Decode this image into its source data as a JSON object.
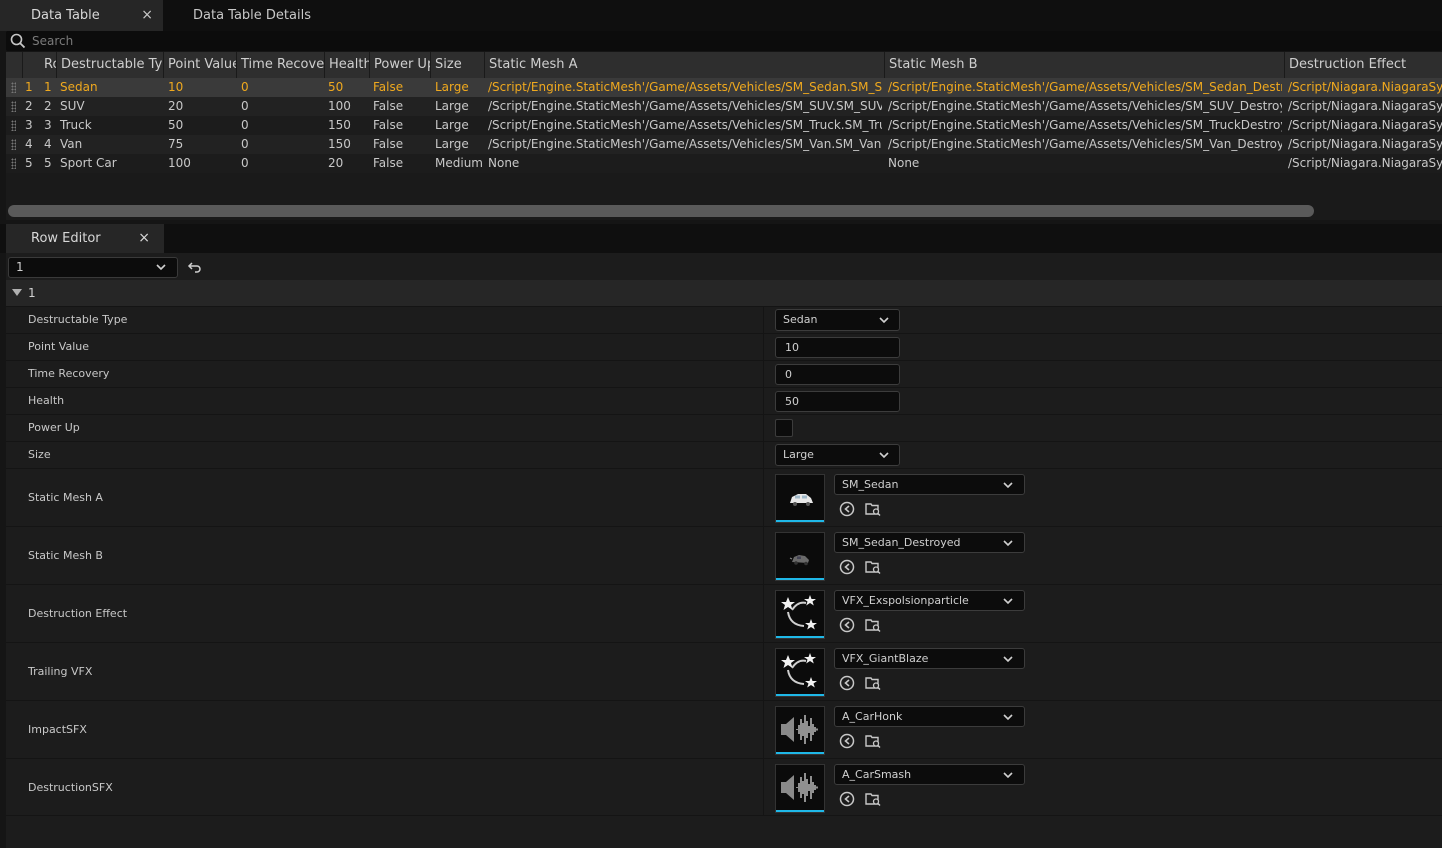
{
  "tabs": [
    {
      "label": "Data Table",
      "close": "×"
    },
    {
      "label": "Data Table Details"
    }
  ],
  "search": {
    "placeholder": "Search"
  },
  "table": {
    "headers": [
      "Ro",
      "Destructable Type",
      "Point Value",
      "Time Recovery",
      "Health",
      "Power Up",
      "Size",
      "Static Mesh A",
      "Static Mesh B",
      "Destruction Effect"
    ],
    "rows": [
      {
        "idx": "1",
        "row": "1",
        "type": "Sedan",
        "points": "10",
        "time": "0",
        "health": "50",
        "power": "False",
        "size": "Large",
        "meshA": "/Script/Engine.StaticMesh'/Game/Assets/Vehicles/SM_Sedan.SM_Sedan'",
        "meshB": "/Script/Engine.StaticMesh'/Game/Assets/Vehicles/SM_Sedan_Destroyed",
        "effect": "/Script/Niagara.NiagaraSystem"
      },
      {
        "idx": "2",
        "row": "2",
        "type": "SUV",
        "points": "20",
        "time": "0",
        "health": "100",
        "power": "False",
        "size": "Large",
        "meshA": "/Script/Engine.StaticMesh'/Game/Assets/Vehicles/SM_SUV.SM_SUV'",
        "meshB": "/Script/Engine.StaticMesh'/Game/Assets/Vehicles/SM_SUV_Destroyed.SM",
        "effect": "/Script/Niagara.NiagaraSystem"
      },
      {
        "idx": "3",
        "row": "3",
        "type": "Truck",
        "points": "50",
        "time": "0",
        "health": "150",
        "power": "False",
        "size": "Large",
        "meshA": "/Script/Engine.StaticMesh'/Game/Assets/Vehicles/SM_Truck.SM_Truck'",
        "meshB": "/Script/Engine.StaticMesh'/Game/Assets/Vehicles/SM_TruckDestroyed.SM",
        "effect": "/Script/Niagara.NiagaraSystem"
      },
      {
        "idx": "4",
        "row": "4",
        "type": "Van",
        "points": "75",
        "time": "0",
        "health": "150",
        "power": "False",
        "size": "Large",
        "meshA": "/Script/Engine.StaticMesh'/Game/Assets/Vehicles/SM_Van.SM_Van'",
        "meshB": "/Script/Engine.StaticMesh'/Game/Assets/Vehicles/SM_Van_Destroyed.SM",
        "effect": "/Script/Niagara.NiagaraSystem"
      },
      {
        "idx": "5",
        "row": "5",
        "type": "Sport Car",
        "points": "100",
        "time": "0",
        "health": "20",
        "power": "False",
        "size": "Medium",
        "meshA": "None",
        "meshB": "None",
        "effect": "/Script/Niagara.NiagaraSystem"
      }
    ]
  },
  "row_editor": {
    "tab_label": "Row Editor",
    "tab_close": "×",
    "selected_row": "1",
    "section_label": "1",
    "props": {
      "destructable_type": {
        "label": "Destructable Type",
        "value": "Sedan"
      },
      "point_value": {
        "label": "Point Value",
        "value": "10"
      },
      "time_recovery": {
        "label": "Time Recovery",
        "value": "0"
      },
      "health": {
        "label": "Health",
        "value": "50"
      },
      "power_up": {
        "label": "Power Up",
        "checked": false
      },
      "size": {
        "label": "Size",
        "value": "Large"
      },
      "static_mesh_a": {
        "label": "Static Mesh A",
        "asset": "SM_Sedan",
        "icon": "car-mesh-icon"
      },
      "static_mesh_b": {
        "label": "Static Mesh B",
        "asset": "SM_Sedan_Destroyed",
        "icon": "destroyed-car-mesh-icon"
      },
      "destruction_effect": {
        "label": "Destruction Effect",
        "asset": "VFX_Exspolsionparticle",
        "icon": "niagara-system-icon"
      },
      "trailing_vfx": {
        "label": "Trailing VFX",
        "asset": "VFX_GiantBlaze",
        "icon": "niagara-system-icon"
      },
      "impact_sfx": {
        "label": "ImpactSFX",
        "asset": "A_CarHonk",
        "icon": "sound-wave-icon"
      },
      "destruction_sfx": {
        "label": "DestructionSFX",
        "asset": "A_CarSmash",
        "icon": "sound-wave-icon"
      }
    }
  },
  "colors": {
    "selected_text": "#f0a91e",
    "thumb_accent": "#1fb8e8",
    "background": "#1c1c1c"
  }
}
